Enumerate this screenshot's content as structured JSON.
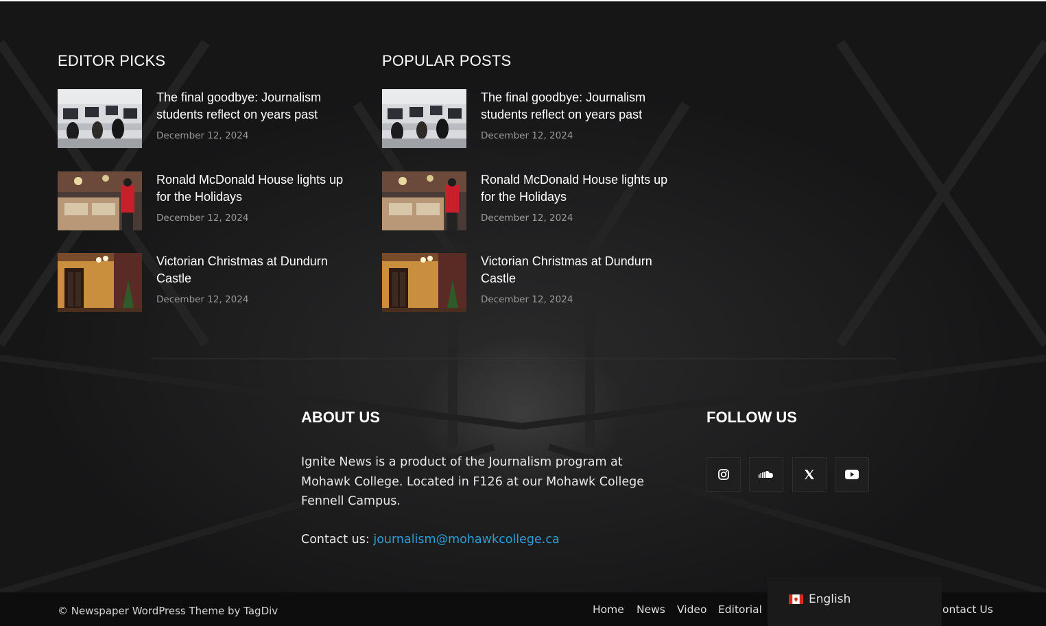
{
  "editor_picks": {
    "title": "EDITOR PICKS",
    "posts": [
      {
        "title": "The final goodbye: Journalism students reflect on years past",
        "date": "December 12, 2024",
        "image": "newsroom-classroom"
      },
      {
        "title": "Ronald McDonald House lights up for the Holidays",
        "date": "December 12, 2024",
        "image": "ronald-mcdonald-house-desk"
      },
      {
        "title": "Victorian Christmas at Dundurn Castle",
        "date": "December 12, 2024",
        "image": "castle-christmas-interior"
      }
    ]
  },
  "popular_posts": {
    "title": "POPULAR POSTS",
    "posts": [
      {
        "title": "The final goodbye: Journalism students reflect on years past",
        "date": "December 12, 2024",
        "image": "newsroom-classroom"
      },
      {
        "title": "Ronald McDonald House lights up for the Holidays",
        "date": "December 12, 2024",
        "image": "ronald-mcdonald-house-desk"
      },
      {
        "title": "Victorian Christmas at Dundurn Castle",
        "date": "December 12, 2024",
        "image": "castle-christmas-interior"
      }
    ]
  },
  "about": {
    "title": "ABOUT US",
    "text": "Ignite News is a product of the Journalism program at Mohawk College. Located in F126 at our Mohawk College Fennell Campus.",
    "contact_label": "Contact us: ",
    "contact_email": "journalism@mohawkcollege.ca"
  },
  "follow": {
    "title": "FOLLOW US",
    "icons": [
      "instagram-icon",
      "soundcloud-icon",
      "x-twitter-icon",
      "youtube-icon"
    ]
  },
  "footer": {
    "copyright": "© Newspaper WordPress Theme by TagDiv",
    "menu": [
      "Home",
      "News",
      "Video",
      "Editorial",
      "ontact Us"
    ]
  },
  "language": {
    "label": "English",
    "flag": "canada-flag-icon"
  },
  "colors": {
    "link": "#2a9fd6",
    "date": "#9a9a9a",
    "background": "#1b1b1c",
    "footer": "#0d0d0d"
  }
}
